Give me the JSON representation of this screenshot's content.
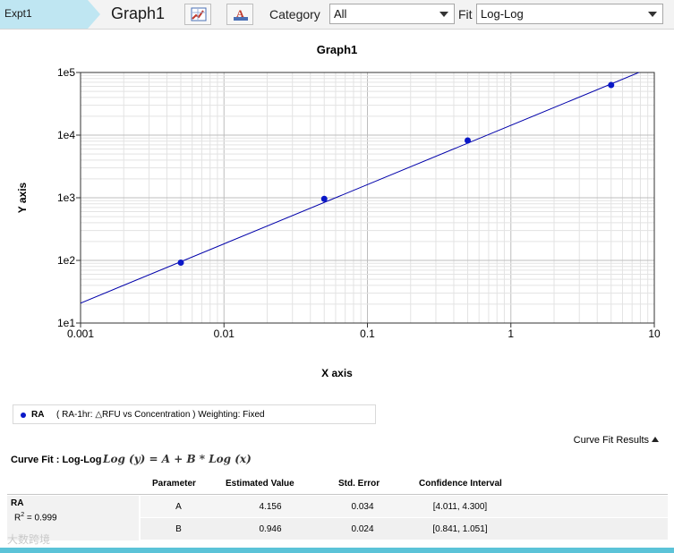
{
  "toolbar": {
    "experiment": "Expt1",
    "graph_tab": "Graph1",
    "category_label": "Category",
    "category_value": "All",
    "fit_label": "Fit",
    "fit_value": "Log-Log",
    "icons": [
      "chart-edit-icon",
      "chart-font-icon"
    ],
    "accent_color": "#5bc3d8"
  },
  "chart_data": {
    "type": "scatter",
    "title": "Graph1",
    "xlabel": "X axis",
    "ylabel": "Y axis",
    "x_scale": "log",
    "y_scale": "log",
    "xlim": [
      0.001,
      10
    ],
    "ylim": [
      10,
      100000
    ],
    "x_ticks": [
      "0.001",
      "0.01",
      "0.1",
      "1",
      "10"
    ],
    "y_ticks": [
      "1e1",
      "1e2",
      "1e3",
      "1e4",
      "1e5"
    ],
    "grid": true,
    "series": [
      {
        "name": "RA",
        "color": "#0a18c8",
        "points": [
          {
            "x": 0.005,
            "y": 92
          },
          {
            "x": 0.05,
            "y": 960
          },
          {
            "x": 0.5,
            "y": 8200
          },
          {
            "x": 5,
            "y": 63000
          }
        ]
      }
    ],
    "fit": {
      "type": "log-log",
      "A": 4.156,
      "B": 0.946,
      "color": "#0000aa"
    }
  },
  "legend": {
    "name": "RA",
    "description": "( RA-1hr: △RFU vs Concentration )  Weighting: Fixed"
  },
  "results": {
    "toggle_label": "Curve Fit Results",
    "curve_fit_label": "Curve Fit : Log-Log",
    "equation": "Log (y) = A + B * Log (x)",
    "columns": [
      "Parameter",
      "Estimated Value",
      "Std. Error",
      "Confidence Interval"
    ],
    "series_name": "RA",
    "r2_label": "R",
    "r2_value": "= 0.999",
    "rows": [
      {
        "parameter": "A",
        "estimate": "4.156",
        "std_error": "0.034",
        "ci": "[4.011, 4.300]"
      },
      {
        "parameter": "B",
        "estimate": "0.946",
        "std_error": "0.024",
        "ci": "[0.841, 1.051]"
      }
    ]
  },
  "watermark": "大数跨境"
}
